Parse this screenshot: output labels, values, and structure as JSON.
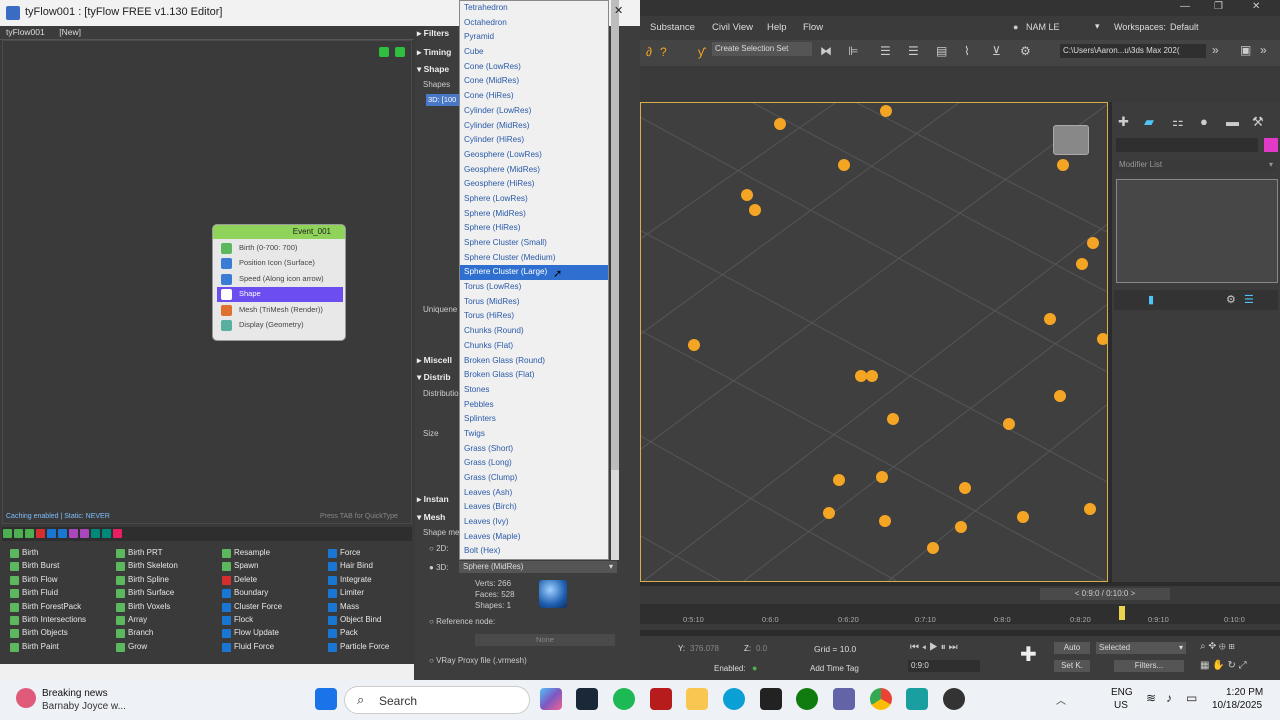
{
  "tyflow": {
    "title": "tyFlow001 : [tyFlow FREE v1.130 Editor]",
    "tab1": "tyFlow001",
    "tab2": "[New]",
    "caching": "Caching enabled | Static: NEVER",
    "press_tab": "Press TAB for QuickType",
    "event": {
      "name": "Event_001",
      "ops": [
        "Birth (0-700: 700)",
        "Position Icon (Surface)",
        "Speed (Along icon arrow)",
        "Shape",
        "Mesh (TriMesh (Render))",
        "Display (Geometry)"
      ]
    },
    "palette": {
      "col1": [
        "Birth",
        "Birth Burst",
        "Birth Flow",
        "Birth Fluid",
        "Birth ForestPack",
        "Birth Intersections",
        "Birth Objects",
        "Birth Paint"
      ],
      "col2": [
        "Birth PRT",
        "Birth Skeleton",
        "Birth Spline",
        "Birth Surface",
        "Birth Voxels",
        "Array",
        "Branch",
        "Grow"
      ],
      "col3": [
        "Resample",
        "Spawn",
        "Delete",
        "Boundary",
        "Cluster Force",
        "Flock",
        "Flow Update",
        "Fluid Force"
      ],
      "col4": [
        "Force",
        "Hair Bind",
        "Integrate",
        "Limiter",
        "Mass",
        "Object Bind",
        "Pack",
        "Particle Force"
      ]
    }
  },
  "panel": {
    "filters": "Filters",
    "timing": "Timing",
    "shape": "Shape",
    "shapes": "Shapes",
    "shape_val": "3D: [100",
    "uniqueness": "Uniquene",
    "misc": "Miscell",
    "distrib": "Distrib",
    "distribution": "Distributio",
    "size": "Size",
    "instance": "Instan",
    "mesh": "Mesh",
    "shape_mesh": "Shape me",
    "opt2d": "2D:",
    "opt3d": "3D:",
    "selected": "Sphere (MidRes)",
    "verts": "Verts: 266",
    "faces": "Faces: 528",
    "shapes_count": "Shapes: 1",
    "refnode": "Reference node:",
    "none": "None",
    "vray": "VRay Proxy file (.vrmesh)"
  },
  "dropdown": [
    "Tetrahedron",
    "Octahedron",
    "Pyramid",
    "Cube",
    "Cone (LowRes)",
    "Cone (MidRes)",
    "Cone (HiRes)",
    "Cylinder (LowRes)",
    "Cylinder (MidRes)",
    "Cylinder (HiRes)",
    "Geosphere (LowRes)",
    "Geosphere (MidRes)",
    "Geosphere (HiRes)",
    "Sphere (LowRes)",
    "Sphere (MidRes)",
    "Sphere (HiRes)",
    "Sphere Cluster (Small)",
    "Sphere Cluster (Medium)",
    "Sphere Cluster (Large)",
    "Torus (LowRes)",
    "Torus (MidRes)",
    "Torus (HiRes)",
    "Chunks (Round)",
    "Chunks (Flat)",
    "Broken Glass (Round)",
    "Broken Glass (Flat)",
    "Stones",
    "Pebbles",
    "Splinters",
    "Twigs",
    "Grass (Short)",
    "Grass (Long)",
    "Grass (Clump)",
    "Leaves (Ash)",
    "Leaves (Birch)",
    "Leaves (Ivy)",
    "Leaves (Maple)",
    "Bolt (Hex)"
  ],
  "max": {
    "menus": [
      "Substance",
      "Civil View",
      "Help",
      "Flow"
    ],
    "user": "NAM LE",
    "workspaces": "Workspaces:",
    "workspace_val": "Default",
    "selset": "Create Selection Set",
    "path": "C:\\Users\\Aaron...u\\3ds Max 202(",
    "modlist": "Modifier List",
    "frame": "0:9:0 / 0:10:0",
    "ticks": [
      "0:5:10",
      "0:6:0",
      "0:6:20",
      "0:7:10",
      "0:8:0",
      "0:8:20",
      "0:9:10",
      "0:10:0"
    ],
    "y_label": "Y:",
    "y_val": "376.078",
    "z_label": "Z:",
    "z_val": "0.0",
    "grid": "Grid = 10.0",
    "enabled": "Enabled:",
    "addtag": "Add Time Tag",
    "auto": "Auto",
    "selected": "Selected",
    "setk": "Set K.",
    "filters": "Filters...",
    "timefield": "0:9:0"
  },
  "taskbar": {
    "news_title": "Breaking news",
    "news_sub": "Barnaby Joyce w...",
    "search": "Search",
    "lang1": "ENG",
    "lang2": "US",
    "time": "1:20 PM",
    "date": "10/18/2025"
  }
}
